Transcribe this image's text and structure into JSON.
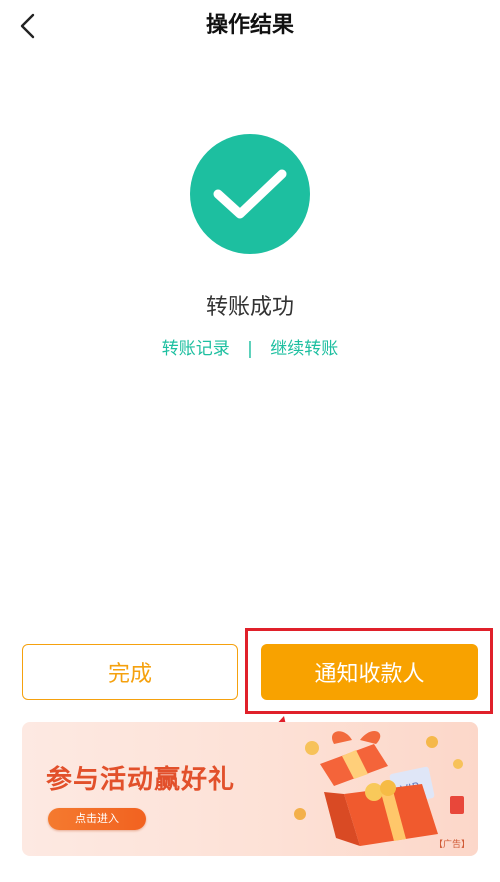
{
  "header": {
    "title": "操作结果"
  },
  "result": {
    "status": "转账成功",
    "link_records": "转账记录",
    "separator": "|",
    "link_continue": "继续转账"
  },
  "actions": {
    "done_label": "完成",
    "notify_label": "通知收款人"
  },
  "banner": {
    "title": "参与活动赢好礼",
    "button_label": "点击进入",
    "ad_label": "【广告】"
  },
  "colors": {
    "brand_green": "#1dbfa0",
    "accent_orange": "#f8a200",
    "annotation_red": "#e0202a",
    "banner_text": "#e2502b"
  },
  "icons": {
    "back": "chevron-left-icon",
    "success": "check-icon",
    "annotation": "arrow-icon"
  }
}
